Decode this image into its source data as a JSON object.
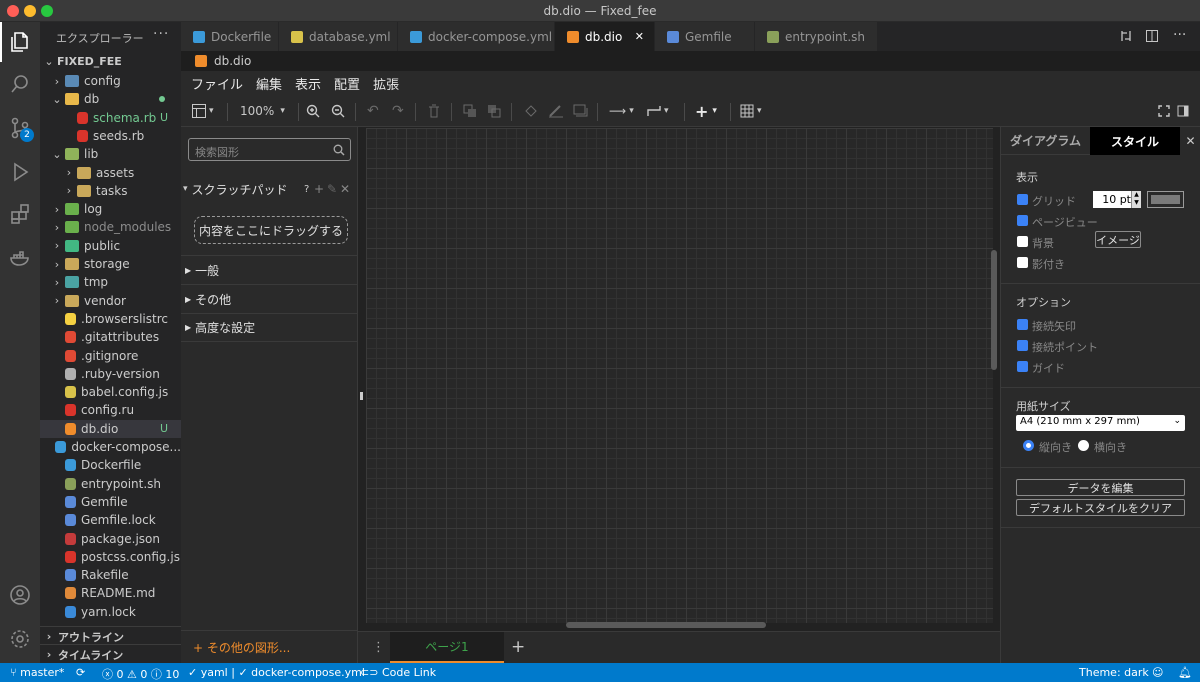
{
  "window": {
    "title": "db.dio — Fixed_fee"
  },
  "sidebar": {
    "title": "エクスプローラー",
    "project": "FIXED_FEE",
    "tree": [
      {
        "label": "config",
        "icon": "folder-config-icon",
        "color": "#5a8ab5",
        "depth": 1,
        "chev": "›",
        "kind": "folder"
      },
      {
        "label": "db",
        "icon": "folder-db-icon",
        "color": "#e8b84a",
        "depth": 1,
        "chev": "⌄",
        "kind": "folder",
        "status": "dot"
      },
      {
        "label": "schema.rb",
        "icon": "ruby-icon",
        "color": "#d9342b",
        "depth": 2,
        "kind": "file",
        "badge": "U",
        "green": true
      },
      {
        "label": "seeds.rb",
        "icon": "ruby-icon",
        "color": "#d9342b",
        "depth": 2,
        "kind": "file"
      },
      {
        "label": "lib",
        "icon": "folder-lib-icon",
        "color": "#8fb35a",
        "depth": 1,
        "chev": "⌄",
        "kind": "folder"
      },
      {
        "label": "assets",
        "icon": "folder-assets-icon",
        "color": "#c9a85a",
        "depth": 2,
        "chev": "›",
        "kind": "folder"
      },
      {
        "label": "tasks",
        "icon": "folder-icon",
        "color": "#c9a85a",
        "depth": 2,
        "chev": "›",
        "kind": "folder"
      },
      {
        "label": "log",
        "icon": "folder-log-icon",
        "color": "#6ab04c",
        "depth": 1,
        "chev": "›",
        "kind": "folder"
      },
      {
        "label": "node_modules",
        "icon": "folder-node-icon",
        "color": "#6ab04c",
        "depth": 1,
        "chev": "›",
        "kind": "folder",
        "dim": true
      },
      {
        "label": "public",
        "icon": "folder-public-icon",
        "color": "#42b883",
        "depth": 1,
        "chev": "›",
        "kind": "folder"
      },
      {
        "label": "storage",
        "icon": "folder-icon",
        "color": "#c9a85a",
        "depth": 1,
        "chev": "›",
        "kind": "folder"
      },
      {
        "label": "tmp",
        "icon": "folder-tmp-icon",
        "color": "#4aa3a3",
        "depth": 1,
        "chev": "›",
        "kind": "folder"
      },
      {
        "label": "vendor",
        "icon": "folder-icon",
        "color": "#c9a85a",
        "depth": 1,
        "chev": "›",
        "kind": "folder"
      },
      {
        "label": ".browserslistrc",
        "icon": "browserslist-icon",
        "color": "#f5d142",
        "depth": 1,
        "kind": "file"
      },
      {
        "label": ".gitattributes",
        "icon": "git-icon",
        "color": "#e04a35",
        "depth": 1,
        "kind": "file"
      },
      {
        "label": ".gitignore",
        "icon": "git-icon",
        "color": "#e04a35",
        "depth": 1,
        "kind": "file"
      },
      {
        "label": ".ruby-version",
        "icon": "file-icon",
        "color": "#b0b0b0",
        "depth": 1,
        "kind": "file"
      },
      {
        "label": "babel.config.js",
        "icon": "babel-icon",
        "color": "#d8c24a",
        "depth": 1,
        "kind": "file"
      },
      {
        "label": "config.ru",
        "icon": "ruby-icon",
        "color": "#d9342b",
        "depth": 1,
        "kind": "file"
      },
      {
        "label": "db.dio",
        "icon": "drawio-icon",
        "color": "#ef8c2c",
        "depth": 1,
        "kind": "file",
        "badge": "U",
        "selected": true
      },
      {
        "label": "docker-compose...",
        "icon": "docker-icon",
        "color": "#3b9ad9",
        "depth": 1,
        "kind": "file"
      },
      {
        "label": "Dockerfile",
        "icon": "docker-icon",
        "color": "#3b9ad9",
        "depth": 1,
        "kind": "file"
      },
      {
        "label": "entrypoint.sh",
        "icon": "shell-icon",
        "color": "#8aa05a",
        "depth": 1,
        "kind": "file"
      },
      {
        "label": "Gemfile",
        "icon": "gemfile-icon",
        "color": "#5a8ad9",
        "depth": 1,
        "kind": "file"
      },
      {
        "label": "Gemfile.lock",
        "icon": "gemfile-icon",
        "color": "#5a8ad9",
        "depth": 1,
        "kind": "file"
      },
      {
        "label": "package.json",
        "icon": "npm-icon",
        "color": "#c43b3b",
        "depth": 1,
        "kind": "file"
      },
      {
        "label": "postcss.config.js",
        "icon": "postcss-icon",
        "color": "#d9342b",
        "depth": 1,
        "kind": "file"
      },
      {
        "label": "Rakefile",
        "icon": "rake-icon",
        "color": "#5a8ad9",
        "depth": 1,
        "kind": "file"
      },
      {
        "label": "README.md",
        "icon": "markdown-icon",
        "color": "#e08a3a",
        "depth": 1,
        "kind": "file"
      },
      {
        "label": "yarn.lock",
        "icon": "yarn-icon",
        "color": "#3a8ad9",
        "depth": 1,
        "kind": "file"
      }
    ],
    "outline": "アウトライン",
    "timeline": "タイムライン"
  },
  "tabs": [
    {
      "label": "Dockerfile",
      "color": "#3b9ad9"
    },
    {
      "label": "database.yml",
      "color": "#d8c24a"
    },
    {
      "label": "docker-compose.yml",
      "color": "#3b9ad9"
    },
    {
      "label": "db.dio",
      "color": "#ef8c2c",
      "active": true
    },
    {
      "label": "Gemfile",
      "color": "#5a8ad9"
    },
    {
      "label": "entrypoint.sh",
      "color": "#8aa05a"
    }
  ],
  "breadcrumb": "db.dio",
  "drawio": {
    "menus": [
      "ファイル",
      "編集",
      "表示",
      "配置",
      "拡張"
    ],
    "zoom": "100%",
    "search_placeholder": "検索図形",
    "scratchpad": "スクラッチパッド",
    "scratchpad_help": "?",
    "dropzone": "内容をここにドラッグする",
    "groups": [
      "一般",
      "その他",
      "高度な設定"
    ],
    "more_shapes": "+ その他の図形...",
    "page_tab": "ページ1"
  },
  "format": {
    "tab_diagram": "ダイアグラム",
    "tab_style": "スタイル",
    "view_title": "表示",
    "grid_label": "グリッド",
    "grid_size": "10 pt",
    "grid_color": "#7a7a7a",
    "page_view": "ページビュー",
    "background": "背景",
    "image_button": "イメージ",
    "shadow": "影付き",
    "options_title": "オプション",
    "connection_arrows": "接続矢印",
    "connection_points": "接続ポイント",
    "guides": "ガイド",
    "paper_title": "用紙サイズ",
    "paper_size": "A4 (210 mm x 297 mm)",
    "portrait": "縦向き",
    "landscape": "横向き",
    "edit_data": "データを編集",
    "clear_style": "デフォルトスタイルをクリア"
  },
  "status": {
    "branch": "master*",
    "errors": "0",
    "warnings": "0",
    "infos": "10",
    "language": "yaml | ✓ docker-compose.yml",
    "codelink": "Code Link",
    "theme": "Theme: dark",
    "scm_badge": "2"
  }
}
